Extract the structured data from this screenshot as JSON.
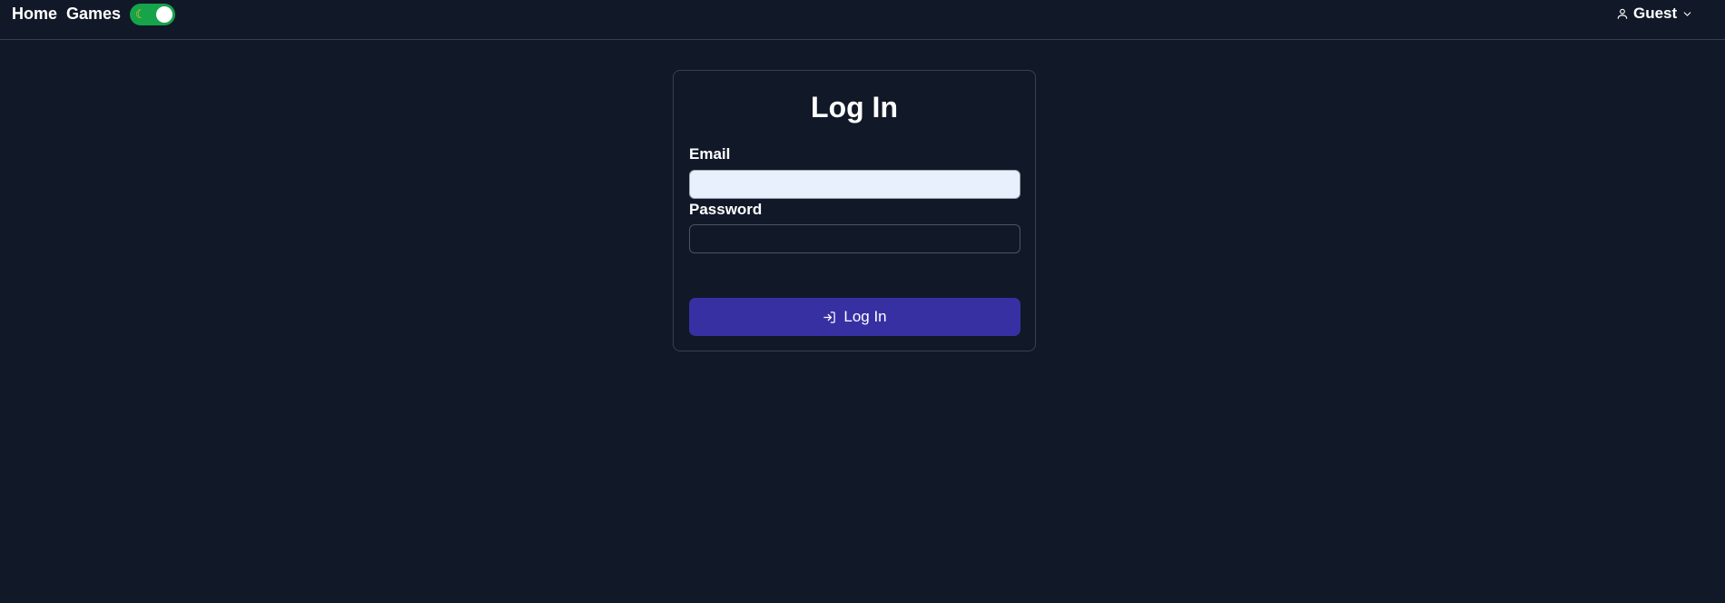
{
  "nav": {
    "home_label": "Home",
    "games_label": "Games",
    "theme_toggle_icon": "moon-icon"
  },
  "user_menu": {
    "icon": "user-icon",
    "label": "Guest",
    "dropdown_icon": "chevron-down-icon"
  },
  "login_form": {
    "title": "Log In",
    "email_label": "Email",
    "email_value": "",
    "password_label": "Password",
    "password_value": "",
    "submit_icon": "log-in-icon",
    "submit_label": "Log In"
  },
  "colors": {
    "background": "#111827",
    "border": "#374151",
    "toggle_on": "#16a34a",
    "primary_button": "#3730a3",
    "autofill_input": "#e8f0fe"
  }
}
